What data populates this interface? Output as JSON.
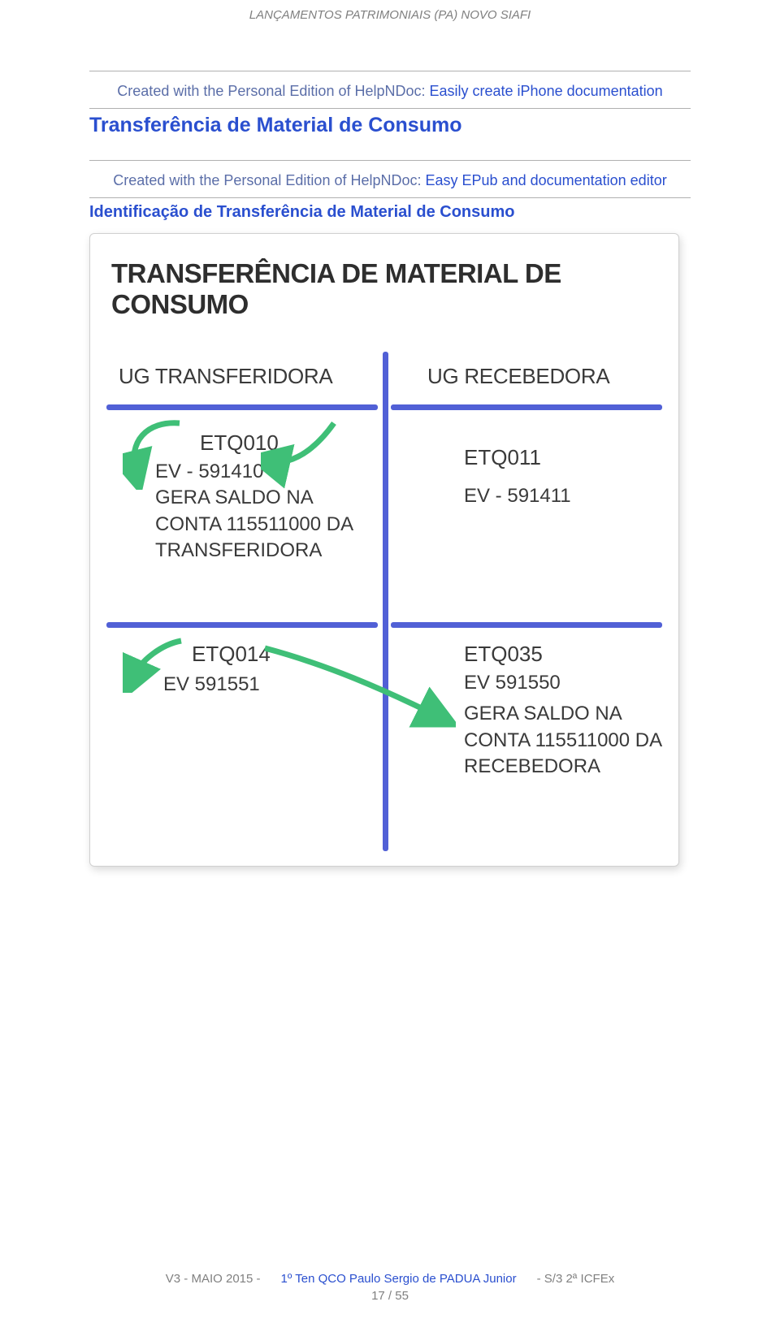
{
  "header": {
    "title": "LANÇAMENTOS PATRIMONIAIS (PA)  NOVO SIAFI"
  },
  "attribution1": {
    "prefix": "Created with the Personal Edition of HelpNDoc: ",
    "link": "Easily create iPhone documentation"
  },
  "section1": "Transferência de Material de Consumo",
  "attribution2": {
    "prefix": "Created with the Personal Edition of HelpNDoc: ",
    "link": "Easy EPub and documentation editor"
  },
  "section2": "Identificação de Transferência de Material de Consumo",
  "diagram": {
    "title": "TRANSFERÊNCIA DE MATERIAL DE CONSUMO",
    "left_header": "UG TRANSFERIDORA",
    "right_header": "UG RECEBEDORA",
    "q1": {
      "code": "ETQ010",
      "ev": "EV - 591410",
      "note": "GERA SALDO NA CONTA 115511000 DA TRANSFERIDORA"
    },
    "q2": {
      "code": "ETQ011",
      "ev": "EV - 591411"
    },
    "q3": {
      "code": "ETQ014",
      "ev": "EV 591551"
    },
    "q4": {
      "code": "ETQ035",
      "ev": "EV 591550",
      "note": "GERA SALDO NA CONTA 115511000 DA RECEBEDORA"
    }
  },
  "footer": {
    "version": "V3  -  MAIO 2015   -",
    "author": "1º Ten QCO Paulo Sergio de PADUA Junior",
    "unit": "-     S/3   2ª ICFEx",
    "page": "17 / 55"
  }
}
